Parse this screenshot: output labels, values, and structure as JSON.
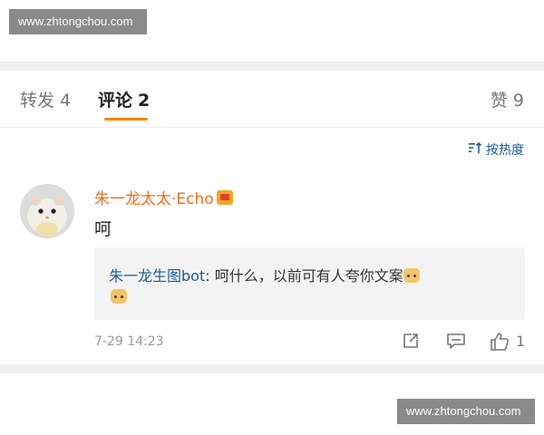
{
  "watermark": {
    "text": "www.zhtongchou.com"
  },
  "tabs": {
    "repost": {
      "label": "转发",
      "count": "4"
    },
    "comment": {
      "label": "评论",
      "count": "2"
    },
    "like": {
      "label": "赞",
      "count": "9"
    }
  },
  "sort": {
    "label": "按热度",
    "icon": "sort-icon"
  },
  "comment": {
    "username": "朱一龙太太·Echo",
    "badge_icon": "vip-badge-icon",
    "text": "呵",
    "reply": {
      "user": "朱一龙生图bot",
      "separator": ": ",
      "text": "呵什么，以前可有人夸你文案",
      "emoji": "cat-emoji"
    },
    "timestamp": "7-29 14:23",
    "like_count": "1",
    "actions": [
      "share-icon",
      "comment-icon",
      "like-icon"
    ]
  }
}
